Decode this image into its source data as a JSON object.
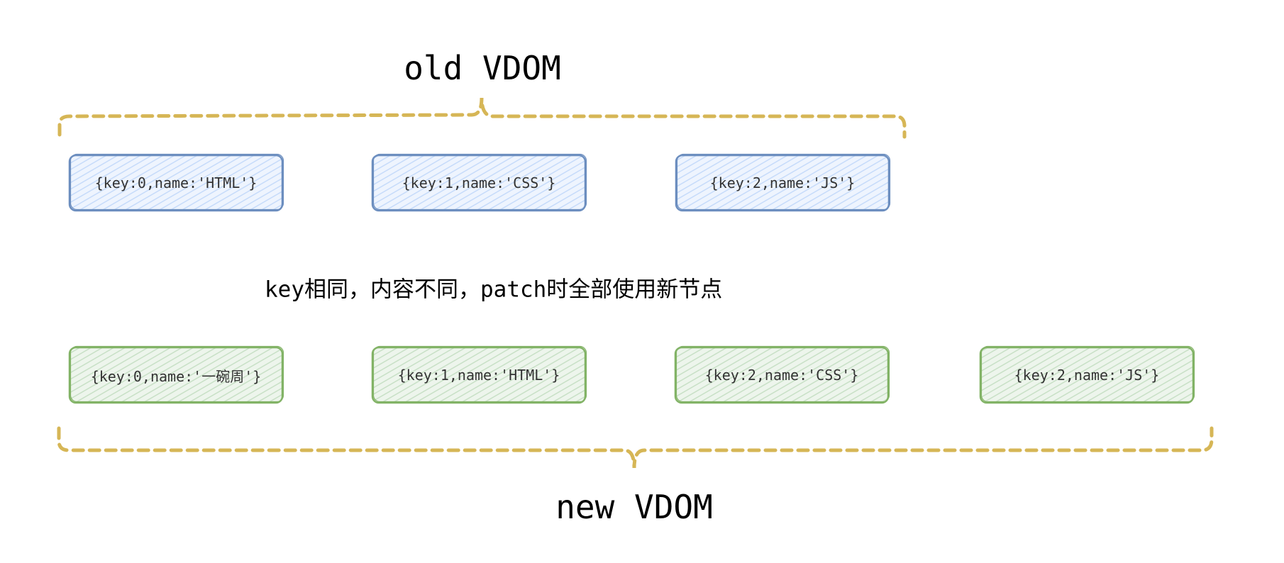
{
  "old_vdom": {
    "title": "old VDOM",
    "nodes": [
      "{key:0,name:'HTML'}",
      "{key:1,name:'CSS'}",
      "{key:2,name:'JS'}"
    ]
  },
  "note": "key相同，内容不同，patch时全部使用新节点",
  "new_vdom": {
    "title": "new VDOM",
    "nodes": [
      "{key:0,name:'一碗周'}",
      "{key:1,name:'HTML'}",
      "{key:2,name:'CSS'}",
      "{key:2,name:'JS'}"
    ]
  },
  "colors": {
    "old_stroke": "#6c8ebf",
    "old_fill": "#dae8fc",
    "new_stroke": "#82b366",
    "new_fill": "#d5e8d4",
    "brace": "#d6b656"
  }
}
